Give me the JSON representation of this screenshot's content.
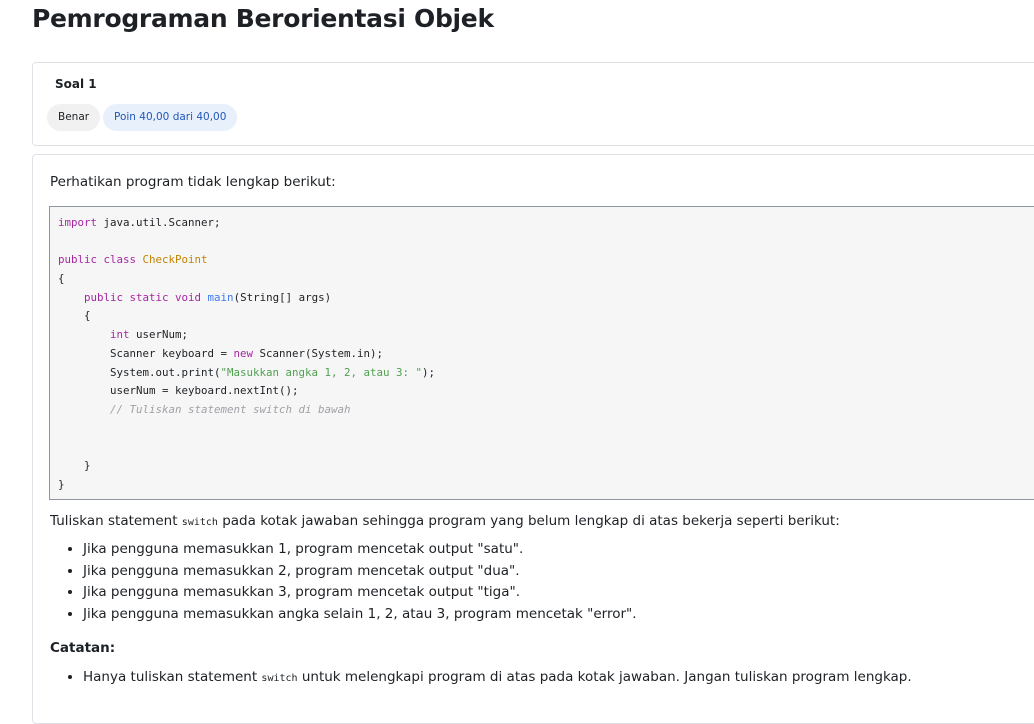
{
  "page": {
    "title": "Pemrograman Berorientasi Objek"
  },
  "question_info": {
    "label": "Soal 1",
    "status": "Benar",
    "points": "Poin 40,00 dari 40,00"
  },
  "question": {
    "intro": "Perhatikan program tidak lengkap berikut:",
    "code": {
      "import_kw": "import",
      "import_rest": " java.util.Scanner;",
      "class_kw": "public class",
      "class_name": "CheckPoint",
      "open_brace": "{",
      "main_indent": "    ",
      "main_kw": "public static void",
      "main_name": "main",
      "main_rest": "(String[] args)",
      "main_open": "    {",
      "int_indent": "        ",
      "int_kw": "int",
      "int_rest": " userNum;",
      "scanner_pre": "        Scanner keyboard = ",
      "scanner_kw": "new",
      "scanner_rest": " Scanner(System.in);",
      "print_pre": "        System.out.print(",
      "print_str": "\"Masukkan angka 1, 2, atau 3: \"",
      "print_rest": ");",
      "read_line": "        userNum = keyboard.nextInt();",
      "comment_indent": "        ",
      "comment": "// Tuliskan statement switch di bawah",
      "main_close": "    }",
      "class_close": "}"
    },
    "instruction_pre": "Tuliskan statement ",
    "instruction_code": "switch",
    "instruction_post": " pada kotak jawaban sehingga program yang belum lengkap di atas bekerja seperti berikut:",
    "requirements": [
      "Jika pengguna memasukkan 1, program mencetak output \"satu\".",
      "Jika pengguna memasukkan 2, program mencetak output \"dua\".",
      "Jika pengguna memasukkan 3, program mencetak output \"tiga\".",
      "Jika pengguna memasukkan angka selain 1, 2, atau 3, program mencetak \"error\"."
    ],
    "note_heading": "Catatan:",
    "note_pre": "Hanya tuliskan statement ",
    "note_code": "switch",
    "note_post": " untuk melengkapi program di atas pada kotak jawaban. Jangan tuliskan program lengkap."
  }
}
